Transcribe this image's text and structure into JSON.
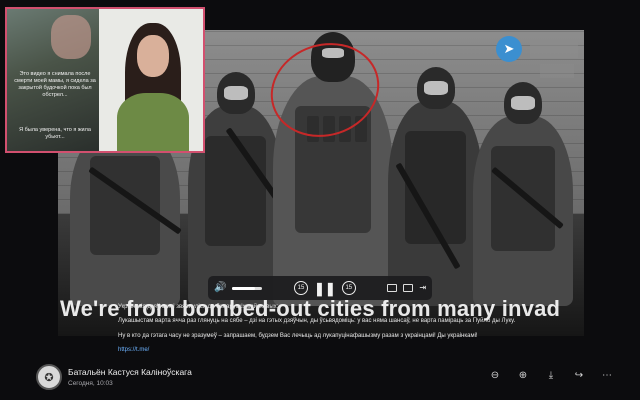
{
  "inset": {
    "caption_top": "Это видео я снимала после смерти моей мамы, я сидела за закрытой будочкой пока был обстрел...",
    "caption_bottom": "Я была уверена, что я жила убьют..."
  },
  "video": {
    "overlay_caption": "We're from bombed-out cities from many invaders,",
    "controls": {
      "volume_level": 0.75,
      "skip_back_label": "15",
      "skip_forward_label": "15"
    }
  },
  "post": {
    "line1": "Украінскія дзяўчынкі звярнуліся да беларускіх вайсковых:",
    "line2": "Лукашыстам варта ячча раз глянуць на сябе – дзі на гэтых дзяўчын, ды ўсьвядоміць: у вас няма шансаў, не варта паміраць за Пуйло ды Луку.",
    "line3": "Ну в кто да гэтага часу не зразумеў – запрашаем, будзем Вас лечыць ад лукапуцінафашызму разам з украінцамі! Ды украінкамі!",
    "link": "https://t.me/"
  },
  "channel": {
    "name": "Батальён Кастуся Каліноўскага",
    "time": "Сегодня, 10:03"
  },
  "icons": {
    "zoom_out": "zoom-out-icon",
    "zoom_in": "zoom-in-icon",
    "download": "download-icon",
    "share": "share-icon",
    "more": "more-icon"
  },
  "colors": {
    "link": "#6db3ff",
    "inset_border": "#d2506f",
    "highlight_circle": "#c62828",
    "telegram": "#3b8fd0"
  }
}
